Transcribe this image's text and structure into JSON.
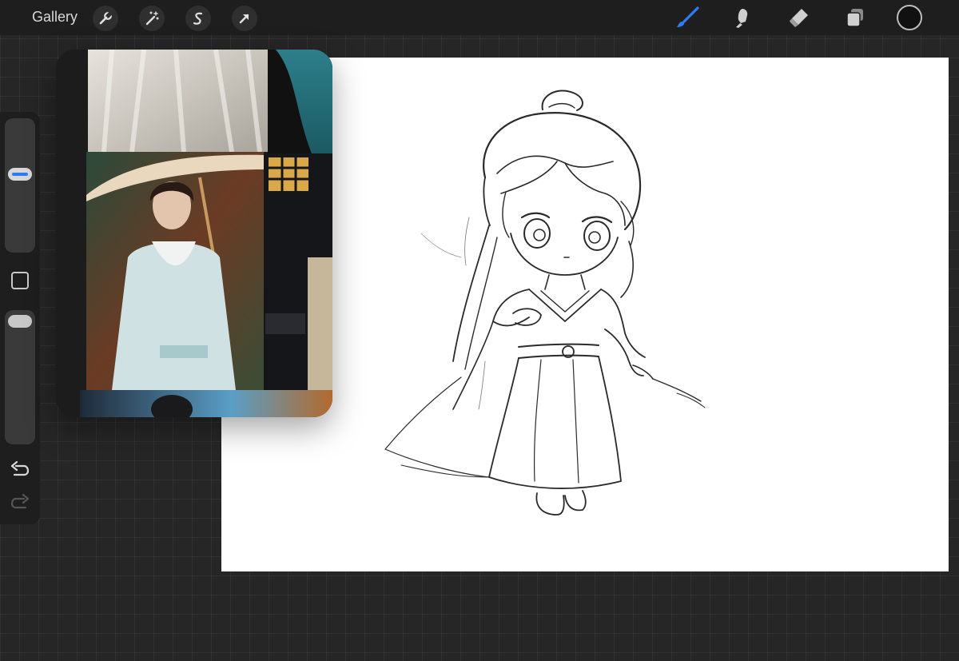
{
  "topbar": {
    "gallery_label": "Gallery",
    "left_tools": [
      {
        "icon": "wrench-icon"
      },
      {
        "icon": "magic-wand-icon"
      },
      {
        "icon": "selection-icon"
      },
      {
        "icon": "transform-arrow-icon"
      }
    ],
    "right_tools": [
      {
        "icon": "brush-icon",
        "active": true
      },
      {
        "icon": "smudge-icon",
        "active": false
      },
      {
        "icon": "eraser-icon",
        "active": false
      },
      {
        "icon": "layers-icon",
        "active": false
      }
    ],
    "current_color": "#111111"
  },
  "sidebar": {
    "brush_size_level": 0.6,
    "opacity_level": 1.0,
    "modify_icon": "square-icon",
    "undo_icon": "undo-icon",
    "redo_icon": "redo-icon"
  },
  "reference_window": {
    "images": [
      "costume-fabric-photo",
      "teal-sleeve-photo",
      "man-with-umbrella-photo",
      "night-street-photo",
      "bottom-strip-photo"
    ]
  },
  "colors": {
    "accent": "#2f7bf6",
    "toolbar_bg": "#1e1e1e",
    "workspace_bg": "#262626",
    "canvas_bg": "#ffffff"
  }
}
